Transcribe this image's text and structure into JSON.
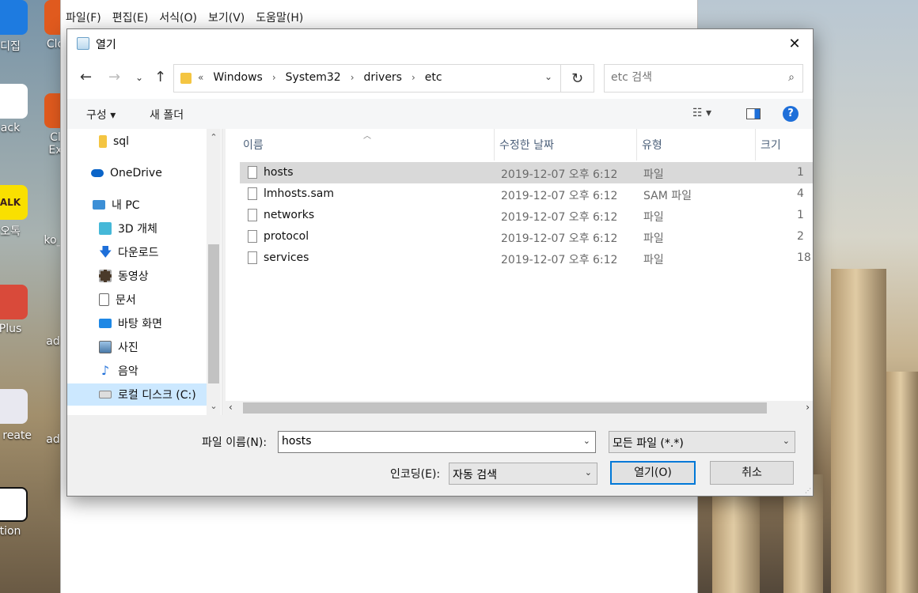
{
  "desktop": {
    "icons": [
      {
        "label": "디집"
      },
      {
        "label": "Clo"
      },
      {
        "label": "ack"
      },
      {
        "label": "Cl Ex"
      },
      {
        "label": "오톡"
      },
      {
        "label": "ko_"
      },
      {
        "label": "Plus"
      },
      {
        "label": "ad"
      },
      {
        "label": "진 reate"
      },
      {
        "label": "ad"
      },
      {
        "label": "tion"
      }
    ],
    "kakao_badge": "ALK"
  },
  "notepad": {
    "menu": [
      "파일(F)",
      "편집(E)",
      "서식(O)",
      "보기(V)",
      "도움말(H)"
    ]
  },
  "dialog": {
    "title": "열기",
    "close_glyph": "✕",
    "nav": {
      "back": "←",
      "forward": "→",
      "recent": "⌄",
      "up": "↑"
    },
    "address": {
      "prefix": "«",
      "crumbs": [
        "Windows",
        "System32",
        "drivers",
        "etc"
      ],
      "separator": "›",
      "dropdown": "⌄",
      "refresh": "↻"
    },
    "search": {
      "placeholder": "etc 검색",
      "icon": "⌕"
    },
    "toolbar": {
      "organize": "구성 ▾",
      "new_folder": "새 폴더",
      "help": "?"
    },
    "navpane": {
      "items": [
        {
          "label": "sql",
          "icon": "folder-icon"
        },
        {
          "label": "OneDrive",
          "icon": "onedrive-icon"
        },
        {
          "label": "내 PC",
          "icon": "pc-icon"
        },
        {
          "label": "3D 개체",
          "icon": "3d-objects-icon"
        },
        {
          "label": "다운로드",
          "icon": "download-icon"
        },
        {
          "label": "동영상",
          "icon": "video-icon"
        },
        {
          "label": "문서",
          "icon": "document-icon"
        },
        {
          "label": "바탕 화면",
          "icon": "desktop-icon"
        },
        {
          "label": "사진",
          "icon": "pictures-icon"
        },
        {
          "label": "음악",
          "icon": "music-icon"
        },
        {
          "label": "로컬 디스크 (C:)",
          "icon": "disk-icon"
        }
      ],
      "selected": "로컬 디스크 (C:)"
    },
    "columns": [
      "이름",
      "수정한 날짜",
      "유형",
      "크기"
    ],
    "files": [
      {
        "name": "hosts",
        "date": "2019-12-07 오후 6:12",
        "type": "파일",
        "size": "1",
        "selected": true
      },
      {
        "name": "lmhosts.sam",
        "date": "2019-12-07 오후 6:12",
        "type": "SAM 파일",
        "size": "4",
        "selected": false
      },
      {
        "name": "networks",
        "date": "2019-12-07 오후 6:12",
        "type": "파일",
        "size": "1",
        "selected": false
      },
      {
        "name": "protocol",
        "date": "2019-12-07 오후 6:12",
        "type": "파일",
        "size": "2",
        "selected": false
      },
      {
        "name": "services",
        "date": "2019-12-07 오후 6:12",
        "type": "파일",
        "size": "18",
        "selected": false
      }
    ],
    "filename_label": "파일 이름(N):",
    "filename_value": "hosts",
    "filetype_value": "모든 파일 (*.*)",
    "encoding_label": "인코딩(E):",
    "encoding_value": "자동 검색",
    "open_button": "열기(O)",
    "cancel_button": "취소"
  }
}
